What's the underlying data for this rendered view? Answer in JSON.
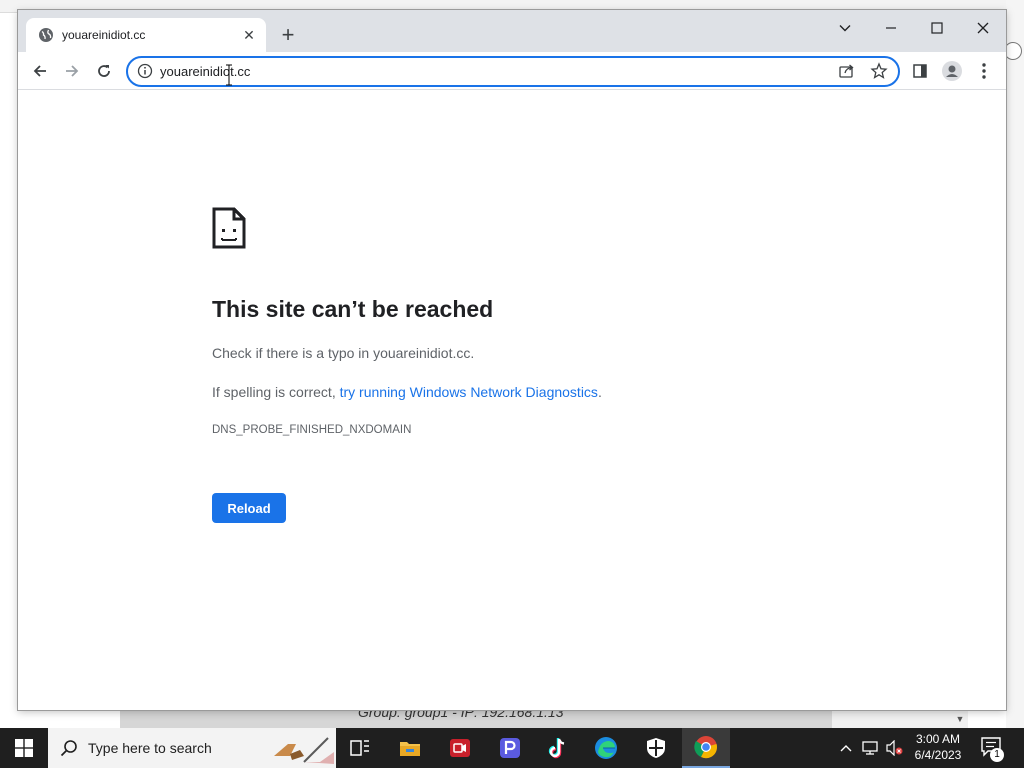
{
  "browser": {
    "tab": {
      "title": "youareinidiot.cc",
      "close_symbol": "✕",
      "favicon": "globe-icon"
    },
    "new_tab_symbol": "+",
    "address_bar": {
      "value": "youareinidiot.cc",
      "left_icon": "info-icon"
    }
  },
  "error_page": {
    "heading": "This site can’t be reached",
    "line1": "Check if there is a typo in youareinidiot.cc.",
    "line2_prefix": "If spelling is correct, ",
    "line2_link": "try running Windows Network Diagnostics",
    "line2_suffix": ".",
    "error_code": "DNS_PROBE_FINISHED_NXDOMAIN",
    "reload_label": "Reload"
  },
  "background_window": {
    "partial_text": "Group: group1 - IP: 192.168.1.13"
  },
  "taskbar": {
    "search_placeholder": "Type here to search",
    "clock_time": "3:00 AM",
    "clock_date": "6/4/2023",
    "notification_count": "1",
    "apps": [
      "task-view-icon",
      "file-explorer-icon",
      "video-recorder-icon",
      "pdf-app-icon",
      "tiktok-icon",
      "edge-icon",
      "security-shield-icon",
      "chrome-icon"
    ]
  },
  "colors": {
    "accent": "#1a73e8",
    "tabstrip": "#dee1e6",
    "taskbar": "#1f1f1f"
  }
}
